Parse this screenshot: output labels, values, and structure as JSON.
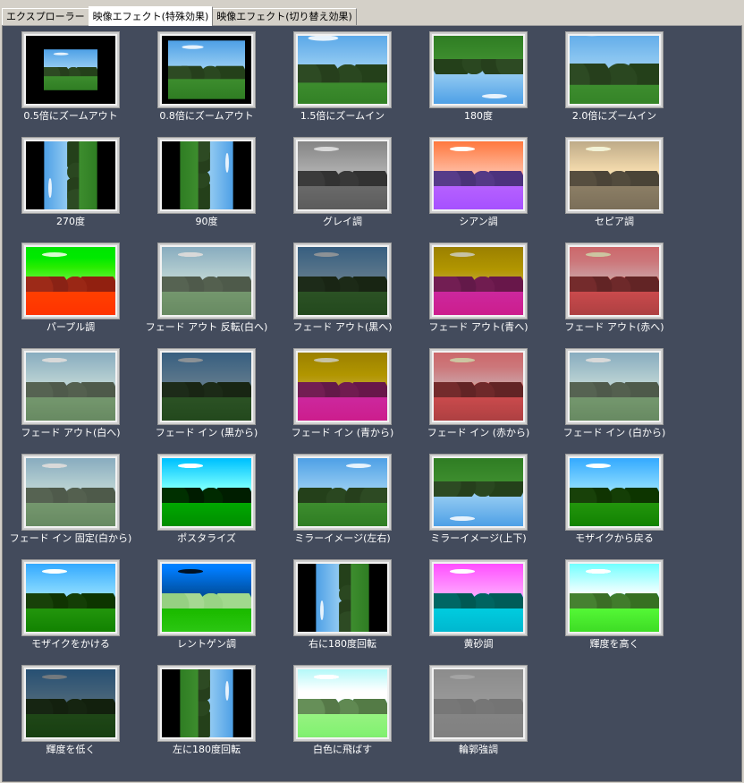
{
  "tabs": [
    {
      "label": "エクスプローラー",
      "active": false
    },
    {
      "label": "映像エフェクト(特殊効果)",
      "active": true
    },
    {
      "label": "映像エフェクト(切り替え効果)",
      "active": false
    }
  ],
  "effects": [
    {
      "label": "0.5倍にズームアウト"
    },
    {
      "label": "0.8倍にズームアウト"
    },
    {
      "label": "1.5倍にズームイン"
    },
    {
      "label": "180度"
    },
    {
      "label": "2.0倍にズームイン"
    },
    {
      "label": "270度"
    },
    {
      "label": "90度"
    },
    {
      "label": "グレイ調"
    },
    {
      "label": "シアン調"
    },
    {
      "label": "セピア調"
    },
    {
      "label": "パープル調"
    },
    {
      "label": "フェード アウト 反転(白へ)"
    },
    {
      "label": "フェード アウト(黒へ)"
    },
    {
      "label": "フェード アウト(青へ)"
    },
    {
      "label": "フェード アウト(赤へ)"
    },
    {
      "label": "フェード アウト(白へ)"
    },
    {
      "label": "フェード イン (黒から)"
    },
    {
      "label": "フェード イン (青から)"
    },
    {
      "label": "フェード イン (赤から)"
    },
    {
      "label": "フェード イン (白から)"
    },
    {
      "label": "フェード イン 固定(白から)"
    },
    {
      "label": "ポスタライズ"
    },
    {
      "label": "ミラーイメージ(左右)"
    },
    {
      "label": "ミラーイメージ(上下)"
    },
    {
      "label": "モザイクから戻る"
    },
    {
      "label": "モザイクをかける"
    },
    {
      "label": "レントゲン調"
    },
    {
      "label": "右に180度回転"
    },
    {
      "label": "黄砂調"
    },
    {
      "label": "輝度を高く"
    },
    {
      "label": "輝度を低く"
    },
    {
      "label": "左に180度回転"
    },
    {
      "label": "白色に飛ばす"
    },
    {
      "label": "輪郭強調"
    }
  ]
}
